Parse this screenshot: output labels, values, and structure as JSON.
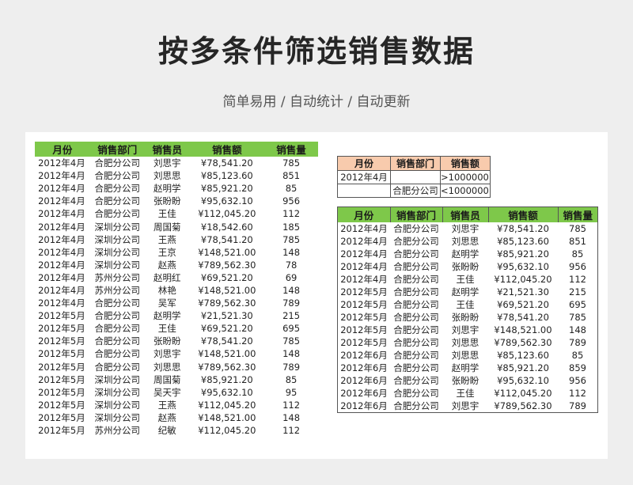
{
  "title": "按多条件筛选销售数据",
  "subtitle": "简单易用 / 自动统计 / 自动更新",
  "colors": {
    "header_green": "#7ec84a",
    "criteria_header": "#f8cbad",
    "background": "#eeeeee"
  },
  "source_table": {
    "headers": [
      "月份",
      "销售部门",
      "销售员",
      "销售额",
      "销售量"
    ],
    "rows": [
      [
        "2012年4月",
        "合肥分公司",
        "刘思宇",
        "¥78,541.20",
        "785"
      ],
      [
        "2012年4月",
        "合肥分公司",
        "刘思思",
        "¥85,123.60",
        "851"
      ],
      [
        "2012年4月",
        "合肥分公司",
        "赵明学",
        "¥85,921.20",
        "85"
      ],
      [
        "2012年4月",
        "合肥分公司",
        "张盼盼",
        "¥95,632.10",
        "956"
      ],
      [
        "2012年4月",
        "合肥分公司",
        "王佳",
        "¥112,045.20",
        "112"
      ],
      [
        "2012年4月",
        "深圳分公司",
        "周国菊",
        "¥18,542.60",
        "185"
      ],
      [
        "2012年4月",
        "深圳分公司",
        "王燕",
        "¥78,541.20",
        "785"
      ],
      [
        "2012年4月",
        "深圳分公司",
        "王京",
        "¥148,521.00",
        "148"
      ],
      [
        "2012年4月",
        "深圳分公司",
        "赵燕",
        "¥789,562.30",
        "78"
      ],
      [
        "2012年4月",
        "苏州分公司",
        "赵明红",
        "¥69,521.20",
        "69"
      ],
      [
        "2012年4月",
        "苏州分公司",
        "林艳",
        "¥148,521.00",
        "148"
      ],
      [
        "2012年4月",
        "合肥分公司",
        "吴军",
        "¥789,562.30",
        "789"
      ],
      [
        "2012年5月",
        "合肥分公司",
        "赵明学",
        "¥21,521.30",
        "215"
      ],
      [
        "2012年5月",
        "合肥分公司",
        "王佳",
        "¥69,521.20",
        "695"
      ],
      [
        "2012年5月",
        "合肥分公司",
        "张盼盼",
        "¥78,541.20",
        "785"
      ],
      [
        "2012年5月",
        "合肥分公司",
        "刘思宇",
        "¥148,521.00",
        "148"
      ],
      [
        "2012年5月",
        "合肥分公司",
        "刘思思",
        "¥789,562.30",
        "789"
      ],
      [
        "2012年5月",
        "深圳分公司",
        "周国菊",
        "¥85,921.20",
        "85"
      ],
      [
        "2012年5月",
        "深圳分公司",
        "吴天宇",
        "¥95,632.10",
        "95"
      ],
      [
        "2012年5月",
        "深圳分公司",
        "王燕",
        "¥112,045.20",
        "112"
      ],
      [
        "2012年5月",
        "深圳分公司",
        "赵燕",
        "¥148,521.00",
        "148"
      ],
      [
        "2012年5月",
        "苏州分公司",
        "纪敏",
        "¥112,045.20",
        "112"
      ]
    ]
  },
  "criteria": {
    "headers": [
      "月份",
      "销售部门",
      "销售额"
    ],
    "rows": [
      [
        "2012年4月",
        "",
        ">1000000"
      ],
      [
        "",
        "合肥分公司",
        "<1000000"
      ]
    ]
  },
  "result_table": {
    "headers": [
      "月份",
      "销售部门",
      "销售员",
      "销售额",
      "销售量"
    ],
    "rows": [
      [
        "2012年4月",
        "合肥分公司",
        "刘思宇",
        "¥78,541.20",
        "785"
      ],
      [
        "2012年4月",
        "合肥分公司",
        "刘思思",
        "¥85,123.60",
        "851"
      ],
      [
        "2012年4月",
        "合肥分公司",
        "赵明学",
        "¥85,921.20",
        "85"
      ],
      [
        "2012年4月",
        "合肥分公司",
        "张盼盼",
        "¥95,632.10",
        "956"
      ],
      [
        "2012年4月",
        "合肥分公司",
        "王佳",
        "¥112,045.20",
        "112"
      ],
      [
        "2012年5月",
        "合肥分公司",
        "赵明学",
        "¥21,521.30",
        "215"
      ],
      [
        "2012年5月",
        "合肥分公司",
        "王佳",
        "¥69,521.20",
        "695"
      ],
      [
        "2012年5月",
        "合肥分公司",
        "张盼盼",
        "¥78,541.20",
        "785"
      ],
      [
        "2012年5月",
        "合肥分公司",
        "刘思宇",
        "¥148,521.00",
        "148"
      ],
      [
        "2012年5月",
        "合肥分公司",
        "刘思思",
        "¥789,562.30",
        "789"
      ],
      [
        "2012年6月",
        "合肥分公司",
        "刘思思",
        "¥85,123.60",
        "85"
      ],
      [
        "2012年6月",
        "合肥分公司",
        "赵明学",
        "¥85,921.20",
        "859"
      ],
      [
        "2012年6月",
        "合肥分公司",
        "张盼盼",
        "¥95,632.10",
        "956"
      ],
      [
        "2012年6月",
        "合肥分公司",
        "王佳",
        "¥112,045.20",
        "112"
      ],
      [
        "2012年6月",
        "合肥分公司",
        "刘思宇",
        "¥789,562.30",
        "789"
      ]
    ]
  }
}
